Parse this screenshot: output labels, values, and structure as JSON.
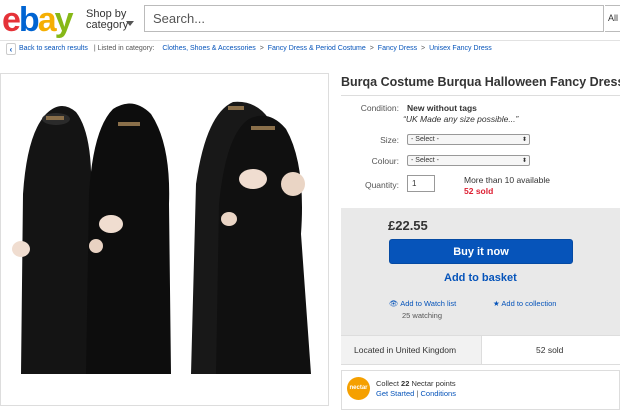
{
  "header": {
    "logo": {
      "letters": [
        "e",
        "b",
        "a",
        "y"
      ],
      "colors": [
        "#e53238",
        "#0064d2",
        "#f5af02",
        "#86b817"
      ]
    },
    "shop_by_line1": "Shop by",
    "shop_by_line2": "category",
    "search_placeholder": "Search...",
    "all_categories": "All C"
  },
  "breadcrumb": {
    "back_label": "Back to search results",
    "listed_label": "| Listed in category:",
    "items": [
      "Clothes, Shoes & Accessories",
      "Fancy Dress & Period Costume",
      "Fancy Dress",
      "Unisex Fancy Dress"
    ],
    "separator": ">"
  },
  "listing": {
    "title": "Burqa Costume Burqua Halloween Fancy Dress Id",
    "condition_label": "Condition:",
    "condition_value": "New without tags",
    "condition_note": "UK Made any size possible...",
    "size_label": "Size:",
    "size_selected": "- Select -",
    "colour_label": "Colour:",
    "colour_selected": "- Select -",
    "quantity_label": "Quantity:",
    "quantity_value": "1",
    "availability": "More than 10 available",
    "sold_count": "52 sold",
    "price": "£22.55",
    "buy_now": "Buy it now",
    "add_to_basket": "Add to basket",
    "watch_list": "Add to Watch list",
    "watching": "25 watching",
    "add_collection": "Add to collection",
    "location": "Located in United Kingdom",
    "sold_total": "52 sold",
    "nectar_logo": "nectar",
    "nectar_prefix": "Collect",
    "nectar_points": "22",
    "nectar_suffix": "Nectar points",
    "get_started": "Get Started",
    "conditions": "Conditions"
  },
  "colors": {
    "accent": "#0654ba",
    "sold_red": "#dd1e31",
    "nectar": "#f5a000"
  }
}
